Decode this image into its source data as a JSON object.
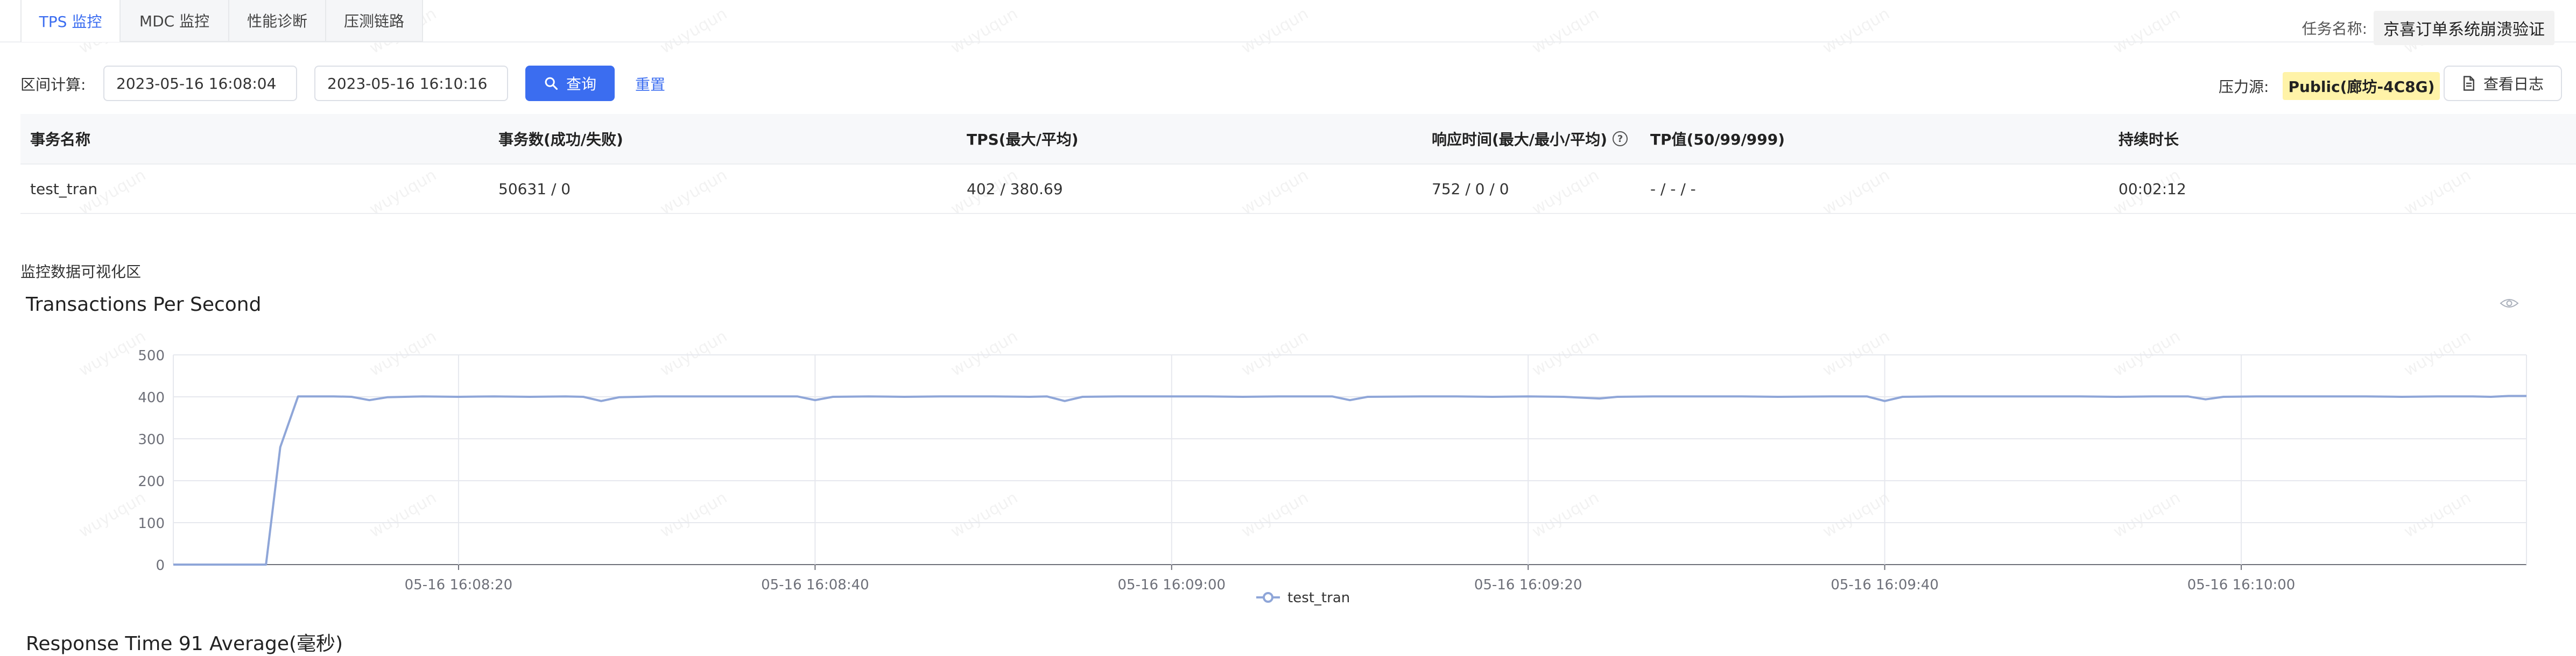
{
  "tabs": [
    {
      "label": "TPS 监控",
      "active": true
    },
    {
      "label": "MDC 监控",
      "active": false
    },
    {
      "label": "性能诊断",
      "active": false
    },
    {
      "label": "压测链路",
      "active": false
    }
  ],
  "task": {
    "label": "任务名称:",
    "name": "京喜订单系统崩溃验证"
  },
  "query": {
    "range_label": "区间计算:",
    "start": "2023-05-16 16:08:04",
    "end": "2023-05-16 16:10:16",
    "query_button": "查询",
    "reset_link": "重置"
  },
  "pressure": {
    "label": "压力源:",
    "source": "Public(廊坊-4C8G)",
    "log_button": "查看日志"
  },
  "table": {
    "headers": [
      "事务名称",
      "事务数(成功/失败)",
      "TPS(最大/平均)",
      "响应时间(最大/最小/平均)",
      "TP值(50/99/999)",
      "持续时长"
    ],
    "rows": [
      [
        "test_tran",
        "50631 / 0",
        "402 / 380.69",
        "752 / 0 / 0",
        "- / - / -",
        "00:02:12"
      ]
    ]
  },
  "visual_section": {
    "title": "监控数据可视化区"
  },
  "watermark_text": "wuyuqun",
  "next_chart_title_partial": "Response Time 91 Average(毫秒)",
  "colors": {
    "accent": "#3b6df0",
    "series": "#8fa6d8",
    "highlight": "#fff3a8"
  },
  "icons": {
    "query": "search-icon",
    "log": "document-icon",
    "chart_toggle": "eye-icon"
  },
  "chart_data": {
    "type": "line",
    "title": "Transactions Per Second",
    "x_label": "",
    "y_label": "",
    "ylim": [
      0,
      500
    ],
    "y_ticks": [
      0,
      100,
      200,
      300,
      400,
      500
    ],
    "x_ticks": [
      "05-16 16:08:20",
      "05-16 16:08:40",
      "05-16 16:09:00",
      "05-16 16:09:20",
      "05-16 16:09:40",
      "05-16 16:10:00"
    ],
    "x_tick_seconds": [
      16,
      36,
      56,
      76,
      96,
      116
    ],
    "x_range_seconds": [
      0,
      132
    ],
    "grid": true,
    "legend": "bottom-center",
    "series": [
      {
        "name": "test_tran",
        "points": [
          [
            0,
            0
          ],
          [
            5,
            0
          ],
          [
            5.2,
            0
          ],
          [
            6,
            280
          ],
          [
            7,
            401
          ],
          [
            9,
            401
          ],
          [
            10,
            400
          ],
          [
            11,
            392
          ],
          [
            12,
            399
          ],
          [
            14,
            401
          ],
          [
            16,
            400
          ],
          [
            18,
            401
          ],
          [
            20,
            400
          ],
          [
            22,
            401
          ],
          [
            23,
            400
          ],
          [
            24,
            390
          ],
          [
            25,
            399
          ],
          [
            27,
            401
          ],
          [
            30,
            401
          ],
          [
            33,
            401
          ],
          [
            35,
            401
          ],
          [
            36,
            392
          ],
          [
            37,
            400
          ],
          [
            39,
            401
          ],
          [
            41,
            400
          ],
          [
            43,
            401
          ],
          [
            46,
            401
          ],
          [
            48,
            400
          ],
          [
            49,
            401
          ],
          [
            50,
            390
          ],
          [
            51,
            400
          ],
          [
            53,
            401
          ],
          [
            56,
            401
          ],
          [
            58,
            401
          ],
          [
            60,
            400
          ],
          [
            62,
            401
          ],
          [
            65,
            401
          ],
          [
            66,
            392
          ],
          [
            67,
            400
          ],
          [
            70,
            401
          ],
          [
            72,
            401
          ],
          [
            74,
            400
          ],
          [
            76,
            401
          ],
          [
            78,
            400
          ],
          [
            80,
            396
          ],
          [
            81,
            400
          ],
          [
            83,
            401
          ],
          [
            86,
            401
          ],
          [
            88,
            401
          ],
          [
            90,
            400
          ],
          [
            93,
            401
          ],
          [
            95,
            401
          ],
          [
            96,
            390
          ],
          [
            97,
            400
          ],
          [
            99,
            401
          ],
          [
            102,
            401
          ],
          [
            105,
            401
          ],
          [
            107,
            401
          ],
          [
            109,
            400
          ],
          [
            111,
            401
          ],
          [
            113,
            401
          ],
          [
            114,
            394
          ],
          [
            115,
            400
          ],
          [
            117,
            401
          ],
          [
            120,
            401
          ],
          [
            123,
            401
          ],
          [
            125,
            400
          ],
          [
            127,
            401
          ],
          [
            129,
            401
          ],
          [
            130,
            400
          ],
          [
            131,
            402
          ],
          [
            132,
            402
          ]
        ]
      }
    ]
  }
}
